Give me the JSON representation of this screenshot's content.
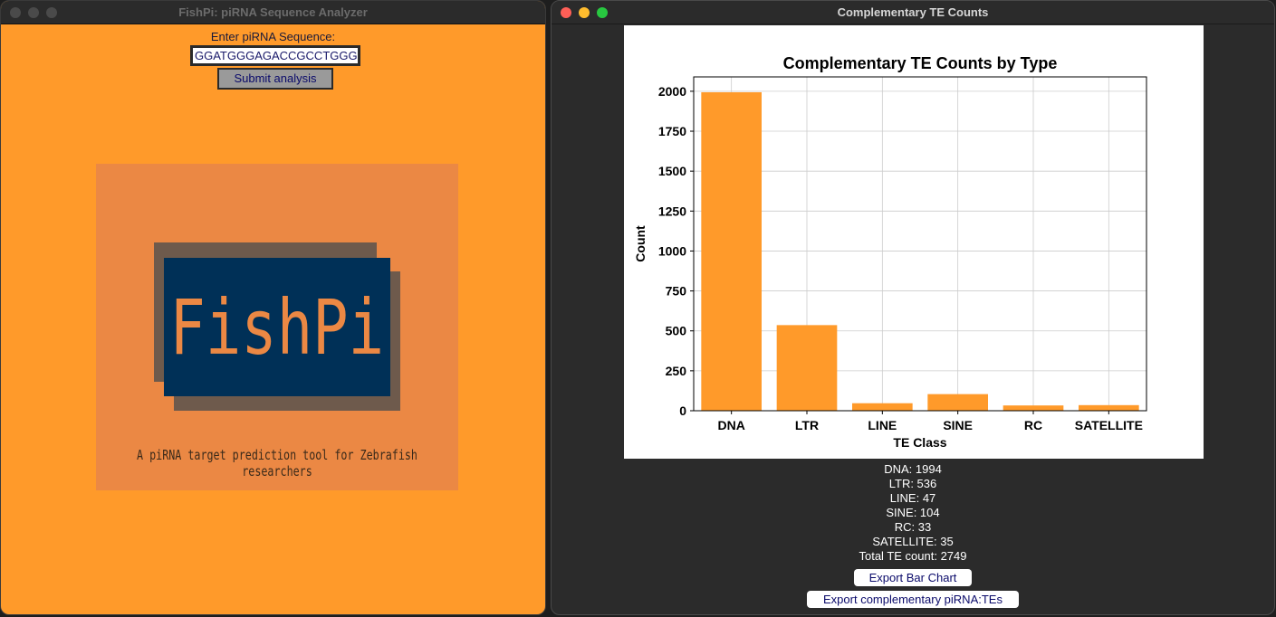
{
  "left_window": {
    "title": "FishPi: piRNA Sequence Analyzer",
    "sequence_label": "Enter piRNA Sequence:",
    "sequence_value": "GGATGGGAGACCGCCTGGG",
    "submit_label": "Submit analysis",
    "logo_text": "FishPi",
    "tagline": "A piRNA target prediction tool for Zebrafish researchers"
  },
  "right_window": {
    "title": "Complementary TE Counts",
    "counts": [
      "DNA: 1994",
      "LTR: 536",
      "LINE: 47",
      "SINE: 104",
      "RC: 33",
      "SATELLITE: 35"
    ],
    "total": "Total TE count: 2749",
    "export_chart_label": "Export Bar Chart",
    "export_pirna_label": "Export complementary piRNA:TEs"
  },
  "colors": {
    "accent_orange": "#ff9a2a",
    "bar_orange": "#ff9a2a",
    "logo_navy": "#003057",
    "logo_panel": "#eb8844"
  },
  "chart_data": {
    "type": "bar",
    "title": "Complementary TE Counts by Type",
    "xlabel": "TE Class",
    "ylabel": "Count",
    "categories": [
      "DNA",
      "LTR",
      "LINE",
      "SINE",
      "RC",
      "SATELLITE"
    ],
    "values": [
      1994,
      536,
      47,
      104,
      33,
      35
    ],
    "ylim": [
      0,
      2090
    ],
    "yticks": [
      0,
      250,
      500,
      750,
      1000,
      1250,
      1500,
      1750,
      2000
    ],
    "grid": true
  }
}
